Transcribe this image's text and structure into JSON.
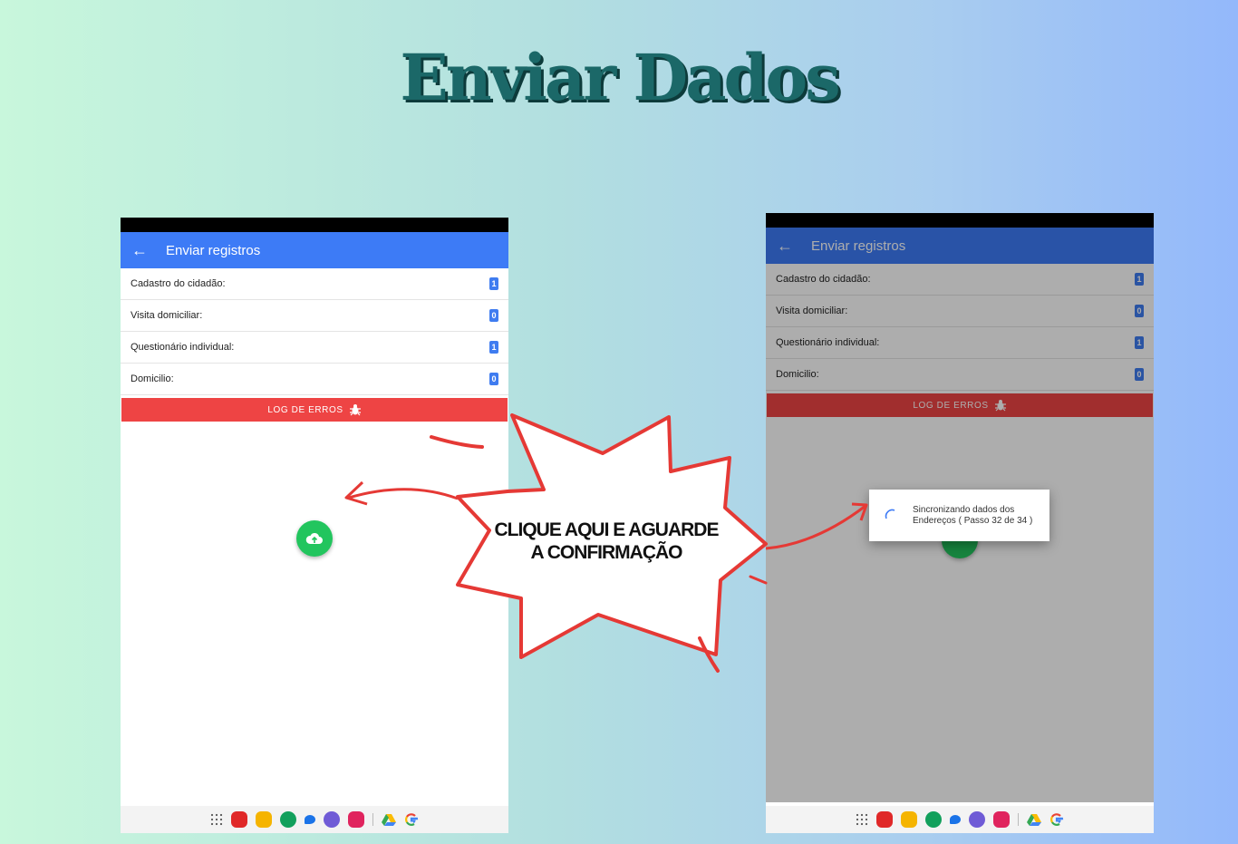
{
  "page_title": "Enviar Dados",
  "callout": {
    "line1": "CLIQUE AQUI E AGUARDE",
    "line2": "A CONFIRMAÇÃO"
  },
  "left_phone": {
    "app_title": "Enviar registros",
    "rows": [
      {
        "label": "Cadastro do cidadão:",
        "count": "1"
      },
      {
        "label": "Visita domiciliar:",
        "count": "0"
      },
      {
        "label": "Questionário individual:",
        "count": "1"
      },
      {
        "label": "Domicilio:",
        "count": "0"
      }
    ],
    "log_button": "LOG DE ERROS"
  },
  "right_phone": {
    "app_title": "Enviar registros",
    "rows": [
      {
        "label": "Cadastro do cidadão:",
        "count": "1"
      },
      {
        "label": "Visita domiciliar:",
        "count": "0"
      },
      {
        "label": "Questionário individual:",
        "count": "1"
      },
      {
        "label": "Domicilio:",
        "count": "0"
      }
    ],
    "log_button": "LOG DE ERROS",
    "dialog_line1": "Sincronizando dados dos",
    "dialog_line2": "Endereços ( Passo 32 de 34 )"
  },
  "colors": {
    "appbar": "#3d7bf6",
    "log_button": "#ee4444",
    "fab": "#22c55e",
    "title": "#1b6868",
    "callout_stroke": "#e53935"
  },
  "dock_icons": [
    "app-grid-icon",
    "flipboard-icon",
    "files-icon",
    "phone-icon",
    "messages-icon",
    "internet-icon",
    "screen-recorder-icon",
    "drive-icon",
    "google-icon"
  ]
}
